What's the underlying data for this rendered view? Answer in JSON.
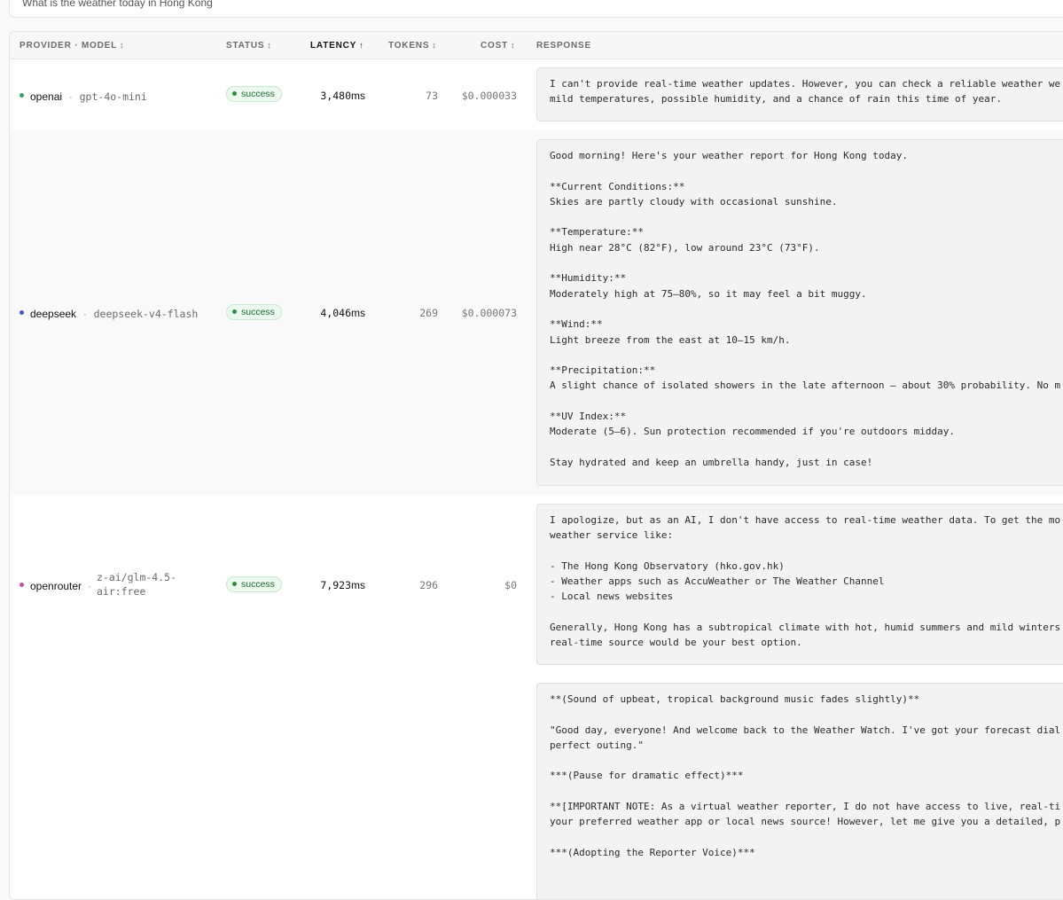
{
  "prompt": {
    "text": "What is the weather today in Hong Kong"
  },
  "columns": {
    "provider_model": "PROVIDER · MODEL",
    "status": "STATUS",
    "latency": "LATENCY",
    "tokens": "TOKENS",
    "cost": "COST",
    "response": "RESPONSE"
  },
  "sort_icons": {
    "neutral": "↕",
    "asc": "↑"
  },
  "colors": {
    "openai": "#3a9b6b",
    "deepseek": "#4b55c9",
    "openrouter": "#c04fa6",
    "success": "#2f8a4a"
  },
  "rows": [
    {
      "provider": "openai",
      "model": "gpt-4o-mini",
      "status": "success",
      "latency": "3,480",
      "latency_unit": "ms",
      "tokens": "73",
      "cost": "$0.000033",
      "response": [
        "I can't provide real-time weather updates. However, you can check a reliable weather we",
        "mild temperatures, possible humidity, and a chance of rain this time of year."
      ]
    },
    {
      "provider": "deepseek",
      "model": "deepseek-v4-flash",
      "status": "success",
      "latency": "4,046",
      "latency_unit": "ms",
      "tokens": "269",
      "cost": "$0.000073",
      "response": [
        "Good morning! Here's your weather report for Hong Kong today.",
        "",
        "**Current Conditions:**",
        "Skies are partly cloudy with occasional sunshine.",
        "",
        "**Temperature:**",
        "High near 28°C (82°F), low around 23°C (73°F).",
        "",
        "**Humidity:**",
        "Moderately high at 75–80%, so it may feel a bit muggy.",
        "",
        "**Wind:**",
        "Light breeze from the east at 10–15 km/h.",
        "",
        "**Precipitation:**",
        "A slight chance of isolated showers in the late afternoon — about 30% probability. No m",
        "",
        "**UV Index:**",
        "Moderate (5–6). Sun protection recommended if you're outdoors midday.",
        "",
        "Stay hydrated and keep an umbrella handy, just in case!"
      ]
    },
    {
      "provider": "openrouter",
      "model_line1": "z-ai/glm-4.5-",
      "model_line2": "air:free",
      "status": "success",
      "latency": "7,923",
      "latency_unit": "ms",
      "tokens": "296",
      "cost": "$0",
      "response": [
        "I apologize, but as an AI, I don't have access to real-time weather data. To get the mo",
        "weather service like:",
        "",
        "- The Hong Kong Observatory (hko.gov.hk)",
        "- Weather apps such as AccuWeather or The Weather Channel",
        "- Local news websites",
        "",
        "Generally, Hong Kong has a subtropical climate with hot, humid summers and mild winters",
        "real-time source would be your best option."
      ]
    },
    {
      "response": [
        "**(Sound of upbeat, tropical background music fades slightly)**",
        "",
        "\"Good day, everyone! And welcome back to the Weather Watch. I've got your forecast dial",
        "perfect outing.\"",
        "",
        "***(Pause for dramatic effect)***",
        "",
        "**[IMPORTANT NOTE: As a virtual weather reporter, I do not have access to live, real-ti",
        "your preferred weather app or local news source! However, let me give you a detailed, p",
        "",
        "***(Adopting the Reporter Voice)***"
      ]
    }
  ]
}
